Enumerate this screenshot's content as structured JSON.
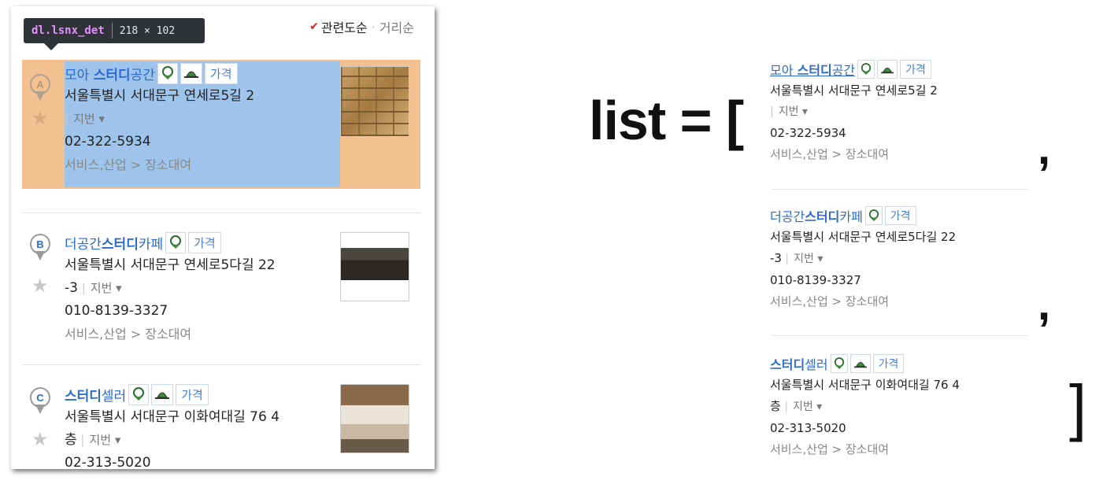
{
  "tooltip": {
    "selector": "dl.lsnx_det",
    "size": "218 × 102"
  },
  "sort": {
    "active": "관련도순",
    "inactive": "거리순",
    "separator": "·"
  },
  "items": [
    {
      "marker": "A",
      "title_pre": "모아 ",
      "title_bold": "스터디",
      "title_post": "공간",
      "address_1": "서울특별시 서대문구 연세로5길 2",
      "address_2": "",
      "lot_label": "지번",
      "phone": "02-322-5934",
      "category": "서비스,산업 > 장소대여",
      "price_label": "가격"
    },
    {
      "marker": "B",
      "title_pre": "더공간",
      "title_bold": "스터디",
      "title_post": "카페",
      "address_1": "서울특별시 서대문구 연세로5다길 22",
      "address_2": "-3",
      "lot_label": "지번",
      "phone": "010-8139-3327",
      "category": "서비스,산업 > 장소대여",
      "price_label": "가격"
    },
    {
      "marker": "C",
      "title_pre": "",
      "title_bold": "스터디",
      "title_post": "셀러",
      "address_1": "서울특별시 서대문구 이화여대길 76 4",
      "address_2": "층",
      "lot_label": "지번",
      "phone": "02-313-5020",
      "category": "서비스,산업 > 장소대여",
      "price_label": "가격"
    }
  ],
  "code": {
    "list_open": "list = [",
    "comma": ",",
    "close": "]"
  },
  "icons": {
    "pin": "map-pin-icon",
    "star": "star-icon",
    "parking": "parking-badge-icon",
    "bell": "bell-badge-icon",
    "dropdown": "caret-down-icon"
  },
  "colors": {
    "link": "#2b6bd1",
    "highlight_margin": "#f5c08f",
    "highlight_content": "#9fc4ec",
    "tooltip_bg": "#2f3338",
    "check": "#e02020"
  }
}
